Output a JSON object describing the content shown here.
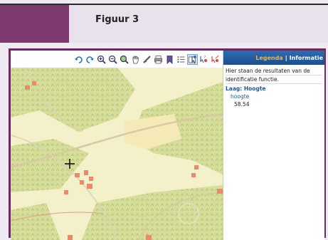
{
  "caption": {
    "figure": "Figuur 3"
  },
  "toolbar": {
    "tools": [
      {
        "icon": "undo-icon",
        "active": false
      },
      {
        "icon": "redo-icon",
        "active": false
      },
      {
        "icon": "zoom-in-icon",
        "active": false
      },
      {
        "icon": "zoom-out-icon",
        "active": false
      },
      {
        "icon": "zoom-extent-icon",
        "active": false
      },
      {
        "icon": "pan-hand-icon",
        "active": false
      },
      {
        "icon": "measure-icon",
        "active": false
      },
      {
        "icon": "print-icon",
        "active": false
      },
      {
        "icon": "bookmark-icon",
        "active": false
      },
      {
        "icon": "legend-list-icon",
        "active": false
      },
      {
        "icon": "identify-icon",
        "active": true
      },
      {
        "icon": "select-features-icon",
        "active": false
      },
      {
        "icon": "clear-selection-icon",
        "active": false
      }
    ]
  },
  "panel": {
    "tab_legend": "Legenda",
    "separator": "|",
    "tab_info": "Informatie",
    "intro_line1": "Hier staan de resultaten van de",
    "intro_line2": "identificatie functie.",
    "layer_label": "Laag: Hoogte",
    "attribute_name": "hoogte",
    "attribute_value": "58.54"
  },
  "colors": {
    "frame": "#6b2a5e",
    "purple_block": "#7c3a6e",
    "map_light": "#f3f0c8",
    "map_forest": "#d6de9a",
    "buildings": "#e98a6a",
    "header_blue": "#2c6db3",
    "legend_orange": "#f5b04a"
  }
}
